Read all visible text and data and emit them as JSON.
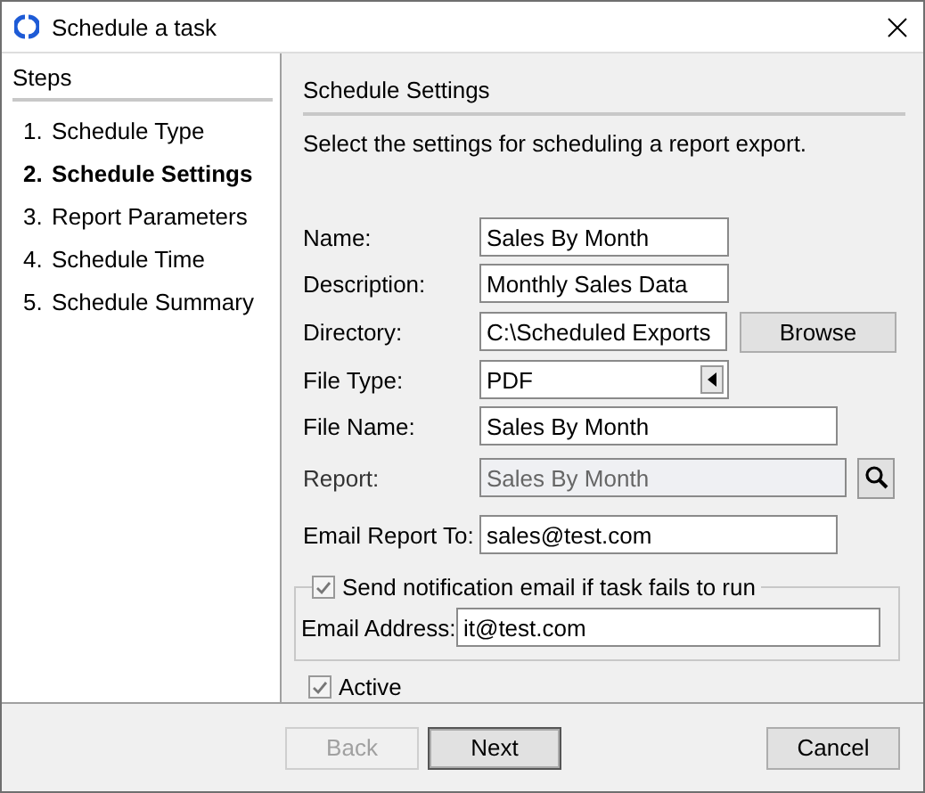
{
  "window": {
    "title": "Schedule a task"
  },
  "steps": {
    "title": "Steps",
    "items": [
      {
        "number": "1.",
        "label": "Schedule Type",
        "selected": false
      },
      {
        "number": "2.",
        "label": "Schedule Settings",
        "selected": true
      },
      {
        "number": "3.",
        "label": "Report Parameters",
        "selected": false
      },
      {
        "number": "4.",
        "label": "Schedule Time",
        "selected": false
      },
      {
        "number": "5.",
        "label": "Schedule Summary",
        "selected": false
      }
    ]
  },
  "settings": {
    "title": "Schedule Settings",
    "description": "Select the settings for scheduling a report export.",
    "fields": [
      {
        "kind": "text",
        "label": "Name:",
        "value": "Sales By Month"
      },
      {
        "kind": "text",
        "label": "Description:",
        "value": "Monthly Sales Data"
      },
      {
        "kind": "browse",
        "label": "Directory:",
        "value": "C:\\Scheduled Exports",
        "button": "Browse"
      },
      {
        "kind": "select",
        "label": "File Type:",
        "value": "PDF"
      },
      {
        "kind": "wide",
        "label": "File Name:",
        "value": "Sales By Month"
      },
      {
        "kind": "lookup",
        "label": "Report:",
        "value": "Sales By Month",
        "disabled": true
      },
      {
        "kind": "wide",
        "label": "Email Report To:",
        "value": "sales@test.com"
      }
    ],
    "notification": {
      "label": "Send notification email if task fails to run",
      "checked": true,
      "email_label": "Email Address:",
      "email": "it@test.com"
    },
    "active": {
      "label": "Active",
      "checked": true
    }
  },
  "buttons": [
    {
      "label": "Back",
      "disabled": true,
      "default": false
    },
    {
      "label": "Next",
      "disabled": false,
      "default": true
    },
    {
      "label": "Cancel",
      "disabled": false,
      "default": false
    }
  ]
}
